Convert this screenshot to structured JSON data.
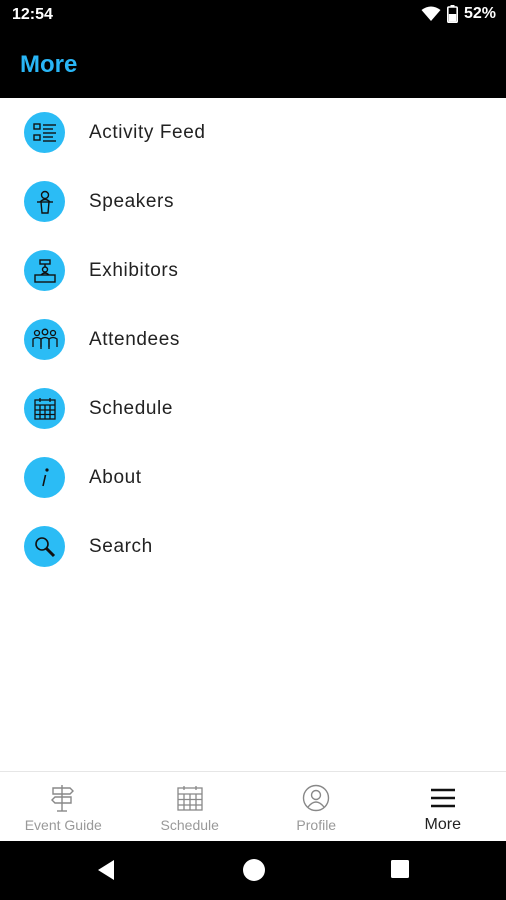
{
  "status": {
    "time": "12:54",
    "battery": "52%"
  },
  "header": {
    "title": "More"
  },
  "menu": {
    "items": [
      {
        "label": "Activity Feed",
        "icon": "list-icon"
      },
      {
        "label": "Speakers",
        "icon": "speaker-podium-icon"
      },
      {
        "label": "Exhibitors",
        "icon": "booth-icon"
      },
      {
        "label": "Attendees",
        "icon": "people-icon"
      },
      {
        "label": "Schedule",
        "icon": "calendar-icon"
      },
      {
        "label": "About",
        "icon": "info-icon"
      },
      {
        "label": "Search",
        "icon": "search-icon"
      }
    ]
  },
  "tabs": [
    {
      "label": "Event Guide",
      "icon": "signpost-icon",
      "active": false
    },
    {
      "label": "Schedule",
      "icon": "calendar-icon",
      "active": false
    },
    {
      "label": "Profile",
      "icon": "profile-icon",
      "active": false
    },
    {
      "label": "More",
      "icon": "menu-icon",
      "active": true
    }
  ],
  "colors": {
    "accent": "#29b6f6",
    "icon_bg": "#2bbcf5",
    "bar_bg": "#000000"
  }
}
